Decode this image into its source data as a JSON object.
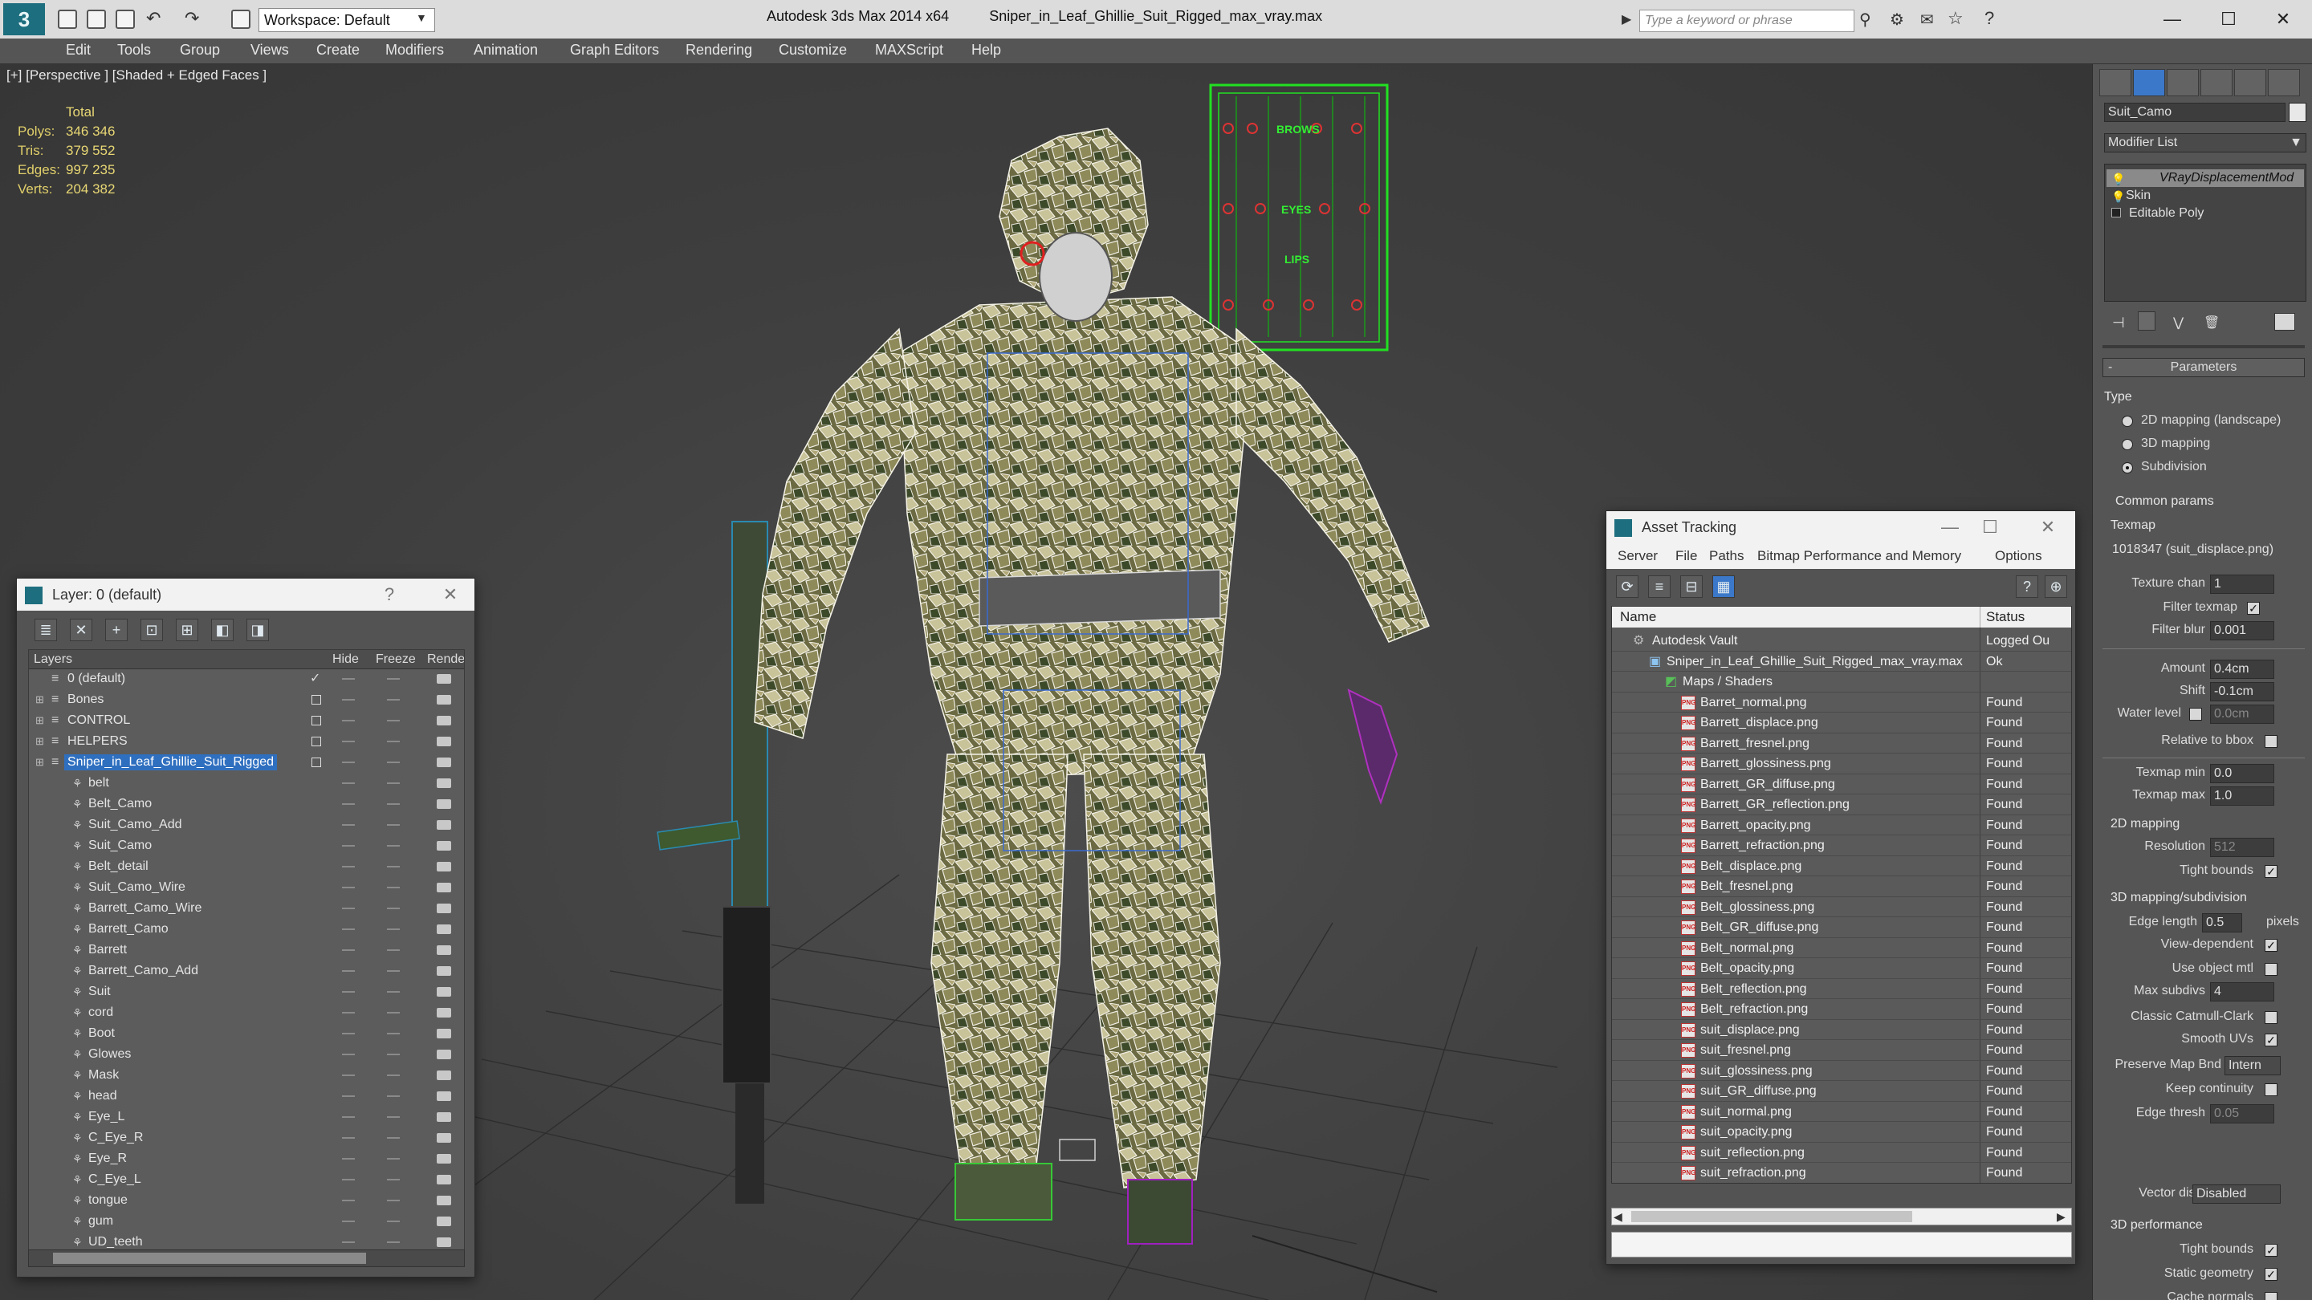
{
  "titlebar": {
    "workspace": "Workspace: Default",
    "app": "Autodesk 3ds Max 2014 x64",
    "file": "Sniper_in_Leaf_Ghillie_Suit_Rigged_max_vray.max",
    "search_placeholder": "Type a keyword or phrase"
  },
  "menu": [
    "Edit",
    "Tools",
    "Group",
    "Views",
    "Create",
    "Modifiers",
    "Animation",
    "Graph Editors",
    "Rendering",
    "Customize",
    "MAXScript",
    "Help"
  ],
  "viewport": {
    "label": "[+] [Perspective ] [Shaded + Edged Faces ]",
    "stats": {
      "header": "Total",
      "polys_label": "Polys:",
      "polys": "346 346",
      "tris_label": "Tris:",
      "tris": "379 552",
      "edges_label": "Edges:",
      "edges": "997 235",
      "verts_label": "Verts:",
      "verts": "204 382"
    },
    "face_panel": {
      "brows": "BROWS",
      "eyes": "EYES",
      "lips": "LIPS"
    }
  },
  "layer_dialog": {
    "title": "Layer: 0 (default)",
    "columns": {
      "layers": "Layers",
      "hide": "Hide",
      "freeze": "Freeze",
      "render": "Render"
    },
    "layers": [
      {
        "name": "0 (default)",
        "check": "✓"
      },
      {
        "name": "Bones"
      },
      {
        "name": "CONTROL"
      },
      {
        "name": "HELPERS"
      },
      {
        "name": "Sniper_in_Leaf_Ghillie_Suit_Rigged"
      }
    ],
    "objects": [
      "belt",
      "Belt_Camo",
      "Suit_Camo_Add",
      "Suit_Camo",
      "Belt_detail",
      "Suit_Camo_Wire",
      "Barrett_Camo_Wire",
      "Barrett_Camo",
      "Barrett",
      "Barrett_Camo_Add",
      "Suit",
      "cord",
      "Boot",
      "Glowes",
      "Mask",
      "head",
      "Eye_L",
      "C_Eye_R",
      "Eye_R",
      "C_Eye_L",
      "tongue",
      "gum",
      "UD_teeth"
    ]
  },
  "asset_dialog": {
    "title": "Asset Tracking",
    "menu": [
      "Server",
      "File",
      "Paths",
      "Bitmap Performance and Memory",
      "Options"
    ],
    "columns": {
      "name": "Name",
      "status": "Status"
    },
    "vault": {
      "name": "Autodesk Vault",
      "status": "Logged Ou"
    },
    "scene": {
      "name": "Sniper_in_Leaf_Ghillie_Suit_Rigged_max_vray.max",
      "status": "Ok"
    },
    "maps": "Maps / Shaders",
    "files": [
      {
        "name": "Barret_normal.png",
        "status": "Found"
      },
      {
        "name": "Barrett_displace.png",
        "status": "Found"
      },
      {
        "name": "Barrett_fresnel.png",
        "status": "Found"
      },
      {
        "name": "Barrett_glossiness.png",
        "status": "Found"
      },
      {
        "name": "Barrett_GR_diffuse.png",
        "status": "Found"
      },
      {
        "name": "Barrett_GR_reflection.png",
        "status": "Found"
      },
      {
        "name": "Barrett_opacity.png",
        "status": "Found"
      },
      {
        "name": "Barrett_refraction.png",
        "status": "Found"
      },
      {
        "name": "Belt_displace.png",
        "status": "Found"
      },
      {
        "name": "Belt_fresnel.png",
        "status": "Found"
      },
      {
        "name": "Belt_glossiness.png",
        "status": "Found"
      },
      {
        "name": "Belt_GR_diffuse.png",
        "status": "Found"
      },
      {
        "name": "Belt_normal.png",
        "status": "Found"
      },
      {
        "name": "Belt_opacity.png",
        "status": "Found"
      },
      {
        "name": "Belt_reflection.png",
        "status": "Found"
      },
      {
        "name": "Belt_refraction.png",
        "status": "Found"
      },
      {
        "name": "suit_displace.png",
        "status": "Found"
      },
      {
        "name": "suit_fresnel.png",
        "status": "Found"
      },
      {
        "name": "suit_glossiness.png",
        "status": "Found"
      },
      {
        "name": "suit_GR_diffuse.png",
        "status": "Found"
      },
      {
        "name": "suit_normal.png",
        "status": "Found"
      },
      {
        "name": "suit_opacity.png",
        "status": "Found"
      },
      {
        "name": "suit_reflection.png",
        "status": "Found"
      },
      {
        "name": "suit_refraction.png",
        "status": "Found"
      }
    ]
  },
  "cmd_panel": {
    "object_name": "Suit_Camo",
    "modifier_list": "Modifier List",
    "stack": [
      "VRayDisplacementMod",
      "Skin",
      "Editable Poly"
    ],
    "rollout": "Parameters",
    "type_label": "Type",
    "type_options": [
      "2D mapping (landscape)",
      "3D mapping",
      "Subdivision"
    ],
    "common_params": "Common params",
    "texmap_label": "Texmap",
    "texmap_value": "1018347 (suit_displace.png)",
    "texture_chan_label": "Texture chan",
    "texture_chan": "1",
    "filter_texmap": "Filter texmap",
    "filter_blur_label": "Filter blur",
    "filter_blur": "0.001",
    "amount_label": "Amount",
    "amount": "0.4cm",
    "shift_label": "Shift",
    "shift": "-0.1cm",
    "water_level_label": "Water level",
    "water_level": "0.0cm",
    "relative_bbox": "Relative to bbox",
    "texmap_min_label": "Texmap min",
    "texmap_min": "0.0",
    "texmap_max_label": "Texmap max",
    "texmap_max": "1.0",
    "mapping_2d": "2D mapping",
    "resolution_label": "Resolution",
    "resolution": "512",
    "tight_bounds": "Tight bounds",
    "mapping_3d": "3D mapping/subdivision",
    "edge_length_label": "Edge length",
    "edge_length": "0.5",
    "pixels": "pixels",
    "view_dependent": "View-dependent",
    "use_object_mtl": "Use object mtl",
    "max_subdivs_label": "Max subdivs",
    "max_subdivs": "4",
    "catmull": "Classic Catmull-Clark",
    "smooth_uvs": "Smooth UVs",
    "preserve_label": "Preserve Map Bnd",
    "preserve": "Intern",
    "keep_continuity": "Keep continuity",
    "edge_thresh_label": "Edge thresh",
    "edge_thresh": "0.05",
    "vector_disp_label": "Vector displ",
    "vector_disp": "Disabled",
    "perf_3d": "3D performance",
    "tight_bounds2": "Tight bounds",
    "static_geometry": "Static geometry",
    "cache_normals": "Cache normals"
  }
}
